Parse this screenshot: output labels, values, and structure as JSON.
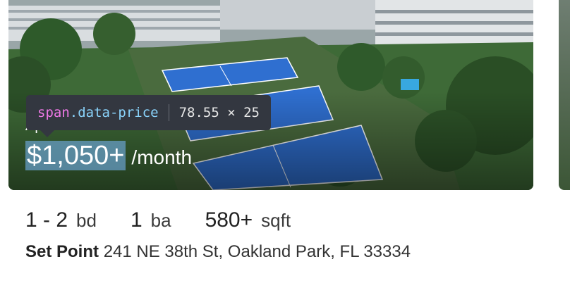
{
  "listing": {
    "type_label": "Apartment for Rent",
    "price": "$1,050+",
    "price_suffix": "/month",
    "beds": "1 - 2",
    "beds_unit": "bd",
    "baths": "1",
    "baths_unit": "ba",
    "sqft": "580+",
    "sqft_unit": "sqft",
    "property_name": "Set Point",
    "address": "241 NE 38th St, Oakland Park, FL 33334"
  },
  "inspector": {
    "tag": "span",
    "class_name": ".data-price",
    "dimensions": "78.55 × 25"
  },
  "colors": {
    "price_highlight": "#6fa8dc",
    "tooltip_bg": "#333740",
    "tooltip_tag": "#ee78e6",
    "tooltip_class": "#8ad3fb",
    "court_blue": "#2f6fd0",
    "turf_green": "#3f6b3a"
  }
}
